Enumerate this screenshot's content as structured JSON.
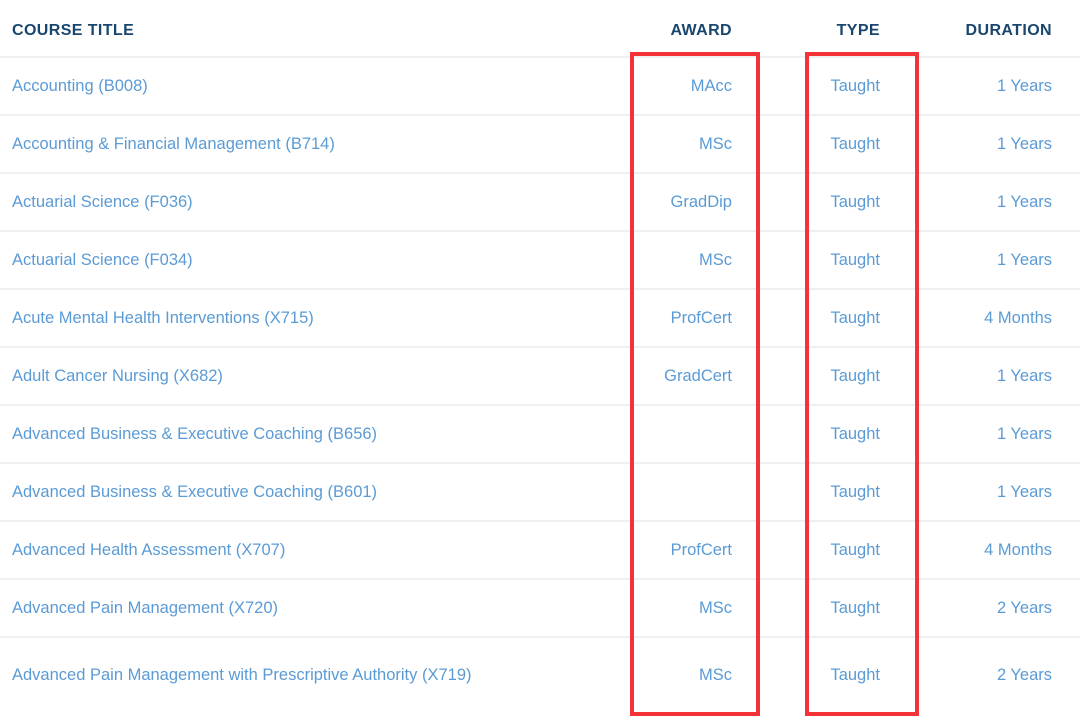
{
  "table": {
    "columns": [
      {
        "key": "title",
        "label": "COURSE TITLE",
        "align": "left"
      },
      {
        "key": "award",
        "label": "AWARD",
        "align": "right"
      },
      {
        "key": "type",
        "label": "TYPE",
        "align": "right"
      },
      {
        "key": "duration",
        "label": "DURATION",
        "align": "right"
      }
    ],
    "rows": [
      {
        "title": "Accounting (B008)",
        "award": "MAcc",
        "type": "Taught",
        "duration": "1 Years"
      },
      {
        "title": "Accounting & Financial Management (B714)",
        "award": "MSc",
        "type": "Taught",
        "duration": "1 Years"
      },
      {
        "title": "Actuarial Science (F036)",
        "award": "GradDip",
        "type": "Taught",
        "duration": "1 Years"
      },
      {
        "title": "Actuarial Science (F034)",
        "award": "MSc",
        "type": "Taught",
        "duration": "1 Years"
      },
      {
        "title": "Acute Mental Health Interventions (X715)",
        "award": "ProfCert",
        "type": "Taught",
        "duration": "4 Months"
      },
      {
        "title": "Adult Cancer Nursing (X682)",
        "award": "GradCert",
        "type": "Taught",
        "duration": "1 Years"
      },
      {
        "title": "Advanced Business & Executive Coaching (B656)",
        "award": "",
        "type": "Taught",
        "duration": "1 Years"
      },
      {
        "title": "Advanced Business & Executive Coaching (B601)",
        "award": "",
        "type": "Taught",
        "duration": "1 Years"
      },
      {
        "title": "Advanced Health Assessment (X707)",
        "award": "ProfCert",
        "type": "Taught",
        "duration": "4 Months"
      },
      {
        "title": "Advanced Pain Management (X720)",
        "award": "MSc",
        "type": "Taught",
        "duration": "2 Years"
      },
      {
        "title": "Advanced Pain Management with Prescriptive Authority (X719)",
        "award": "MSc",
        "type": "Taught",
        "duration": "2 Years"
      }
    ]
  },
  "annotations": [
    {
      "name": "award-column-highlight",
      "color": "#f33338",
      "target": "AWARD"
    },
    {
      "name": "type-column-highlight",
      "color": "#f33338",
      "target": "TYPE"
    }
  ],
  "colors": {
    "header_text": "#19466e",
    "link_text": "#5b9bd5",
    "row_divider": "#eff0f1",
    "annotation": "#f33338",
    "background": "#ffffff"
  }
}
